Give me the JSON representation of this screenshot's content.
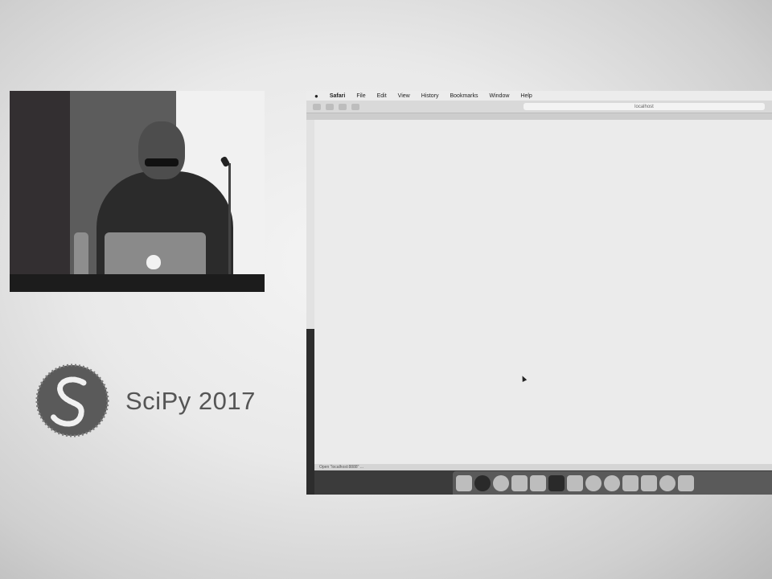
{
  "logo": {
    "text": "SciPy 2017"
  },
  "browser": {
    "menubar": {
      "apple_icon": "apple-icon",
      "app_name": "Safari",
      "items": [
        "File",
        "Edit",
        "View",
        "History",
        "Bookmarks",
        "Window",
        "Help"
      ]
    },
    "address_bar_text": "localhost",
    "status_text": "Open \"localhost:8888\" ..."
  },
  "dock": {
    "icons": [
      "finder-icon",
      "launchpad-icon",
      "safari-icon",
      "mail-icon",
      "notes-icon",
      "terminal-icon",
      "preview-icon",
      "itunes-icon",
      "system-preferences-icon",
      "photos-icon",
      "app-store-icon",
      "folder-icon",
      "trash-icon"
    ]
  }
}
